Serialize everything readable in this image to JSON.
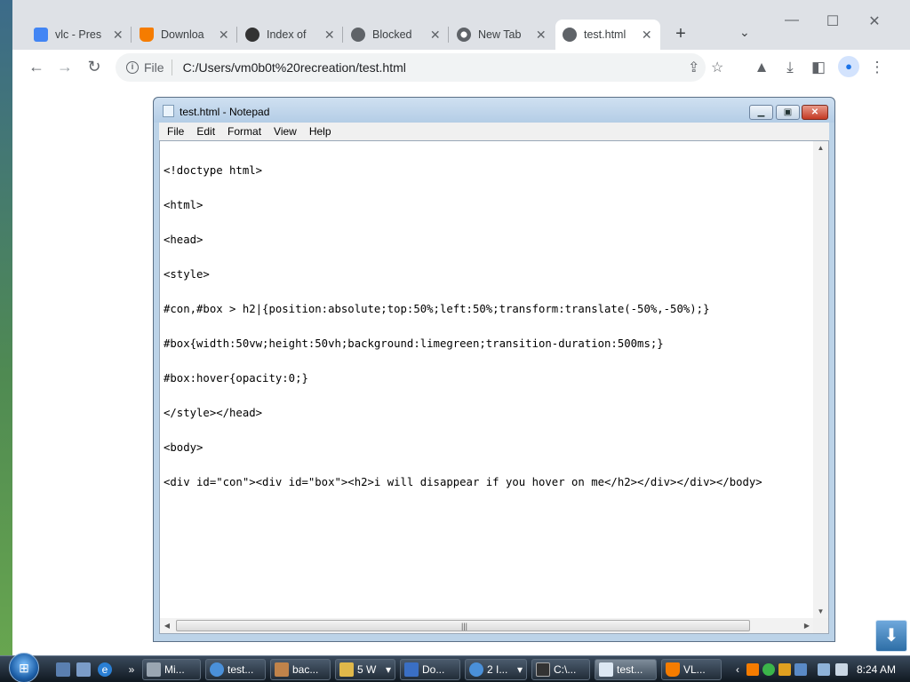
{
  "browser": {
    "tabs": [
      {
        "label": "vlc - Pres",
        "icon": "document-icon",
        "color": "#4285f4"
      },
      {
        "label": "Downloa",
        "icon": "vlc-cone-icon",
        "color": "#f57c00"
      },
      {
        "label": "Index of",
        "icon": "github-icon",
        "color": "#333333"
      },
      {
        "label": "Blocked",
        "icon": "globe-icon",
        "color": "#5f6368"
      },
      {
        "label": "New Tab",
        "icon": "chrome-icon",
        "color": "#5f6368"
      },
      {
        "label": "test.html",
        "icon": "globe-icon",
        "color": "#5f6368"
      }
    ],
    "new_tab_symbol": "+",
    "tab_close_symbol": "✕",
    "address": {
      "scheme_label": "File",
      "url": "C:/Users/vm0b0t%20recreation/test.html"
    }
  },
  "notepad": {
    "title": "test.html - Notepad",
    "menu": [
      "File",
      "Edit",
      "Format",
      "View",
      "Help"
    ],
    "lines": [
      "<!doctype html>",
      "<html>",
      "<head>",
      "<style>",
      "#con,#box > h2|{position:absolute;top:50%;left:50%;transform:translate(-50%,-50%);}",
      "#box{width:50vw;height:50vh;background:limegreen;transition-duration:500ms;}",
      "#box:hover{opacity:0;}",
      "</style></head>",
      "<body>",
      "<div id=\"con\"><div id=\"box\"><h2>i will disappear if you hover on me</h2></div></div></body>"
    ]
  },
  "taskbar": {
    "buttons": [
      {
        "label": "Mi...",
        "color": "#9aa6b2"
      },
      {
        "label": "test...",
        "color": "#4a90d9"
      },
      {
        "label": "bac...",
        "color": "#c0834a"
      },
      {
        "label": "5 W",
        "color": "#e0b84a"
      },
      {
        "label": "Do...",
        "color": "#3a6fc4"
      },
      {
        "label": "2 I...",
        "color": "#4a90d9"
      },
      {
        "label": "C:\\...",
        "color": "#333333"
      },
      {
        "label": "test...",
        "color": "#dde8f3"
      },
      {
        "label": "VL...",
        "color": "#f57c00"
      }
    ],
    "clock": "8:24 AM"
  }
}
